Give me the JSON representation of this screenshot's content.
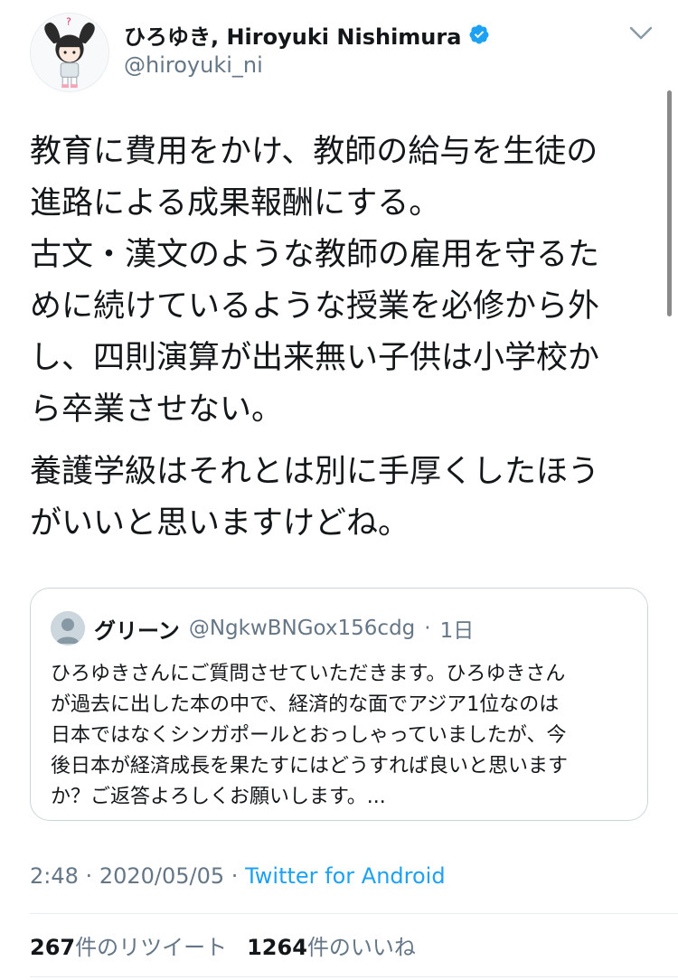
{
  "author": {
    "name": "ひろゆき, Hiroyuki Nishimura",
    "handle": "@hiroyuki_ni",
    "verified": true,
    "avatar_icon": "avatar-illustration-icon"
  },
  "tweet": {
    "paragraphs": [
      "教育に費用をかけ、教師の給与を生徒の\n進路による成果報酬にする。\n古文・漢文のような教師の雇用を守るた\nめに続けているような授業を必修から外\nし、四則演算が出来無い子供は小学校か\nら卒業させない。",
      "養護学級はそれとは別に手厚くしたほう\nがいいと思いますけどね。"
    ]
  },
  "quoted_tweet": {
    "name": "グリーン",
    "handle": "@NgkwBNGox156cdg",
    "age": "1日",
    "separator": "·",
    "text": "ひろゆきさんにご質問させていただきます。ひろゆきさん\nが過去に出した本の中で、経済的な面でアジア1位なのは\n日本ではなくシンガポールとおっしゃっていましたが、今\n後日本が経済成長を果たすにはどうすれば良いと思います\nか？ご返答よろしくお願いします。..."
  },
  "meta": {
    "time": "2:48",
    "date": "2020/05/05",
    "separator": "·",
    "source": "Twitter for Android"
  },
  "stats": {
    "retweets_count": "267",
    "retweets_label": "件のリツイート",
    "likes_count": "1264",
    "likes_label": "件のいいね"
  },
  "colors": {
    "accent": "#1da1f2",
    "secondary_text": "#657786",
    "border": "#ccd6dd"
  }
}
